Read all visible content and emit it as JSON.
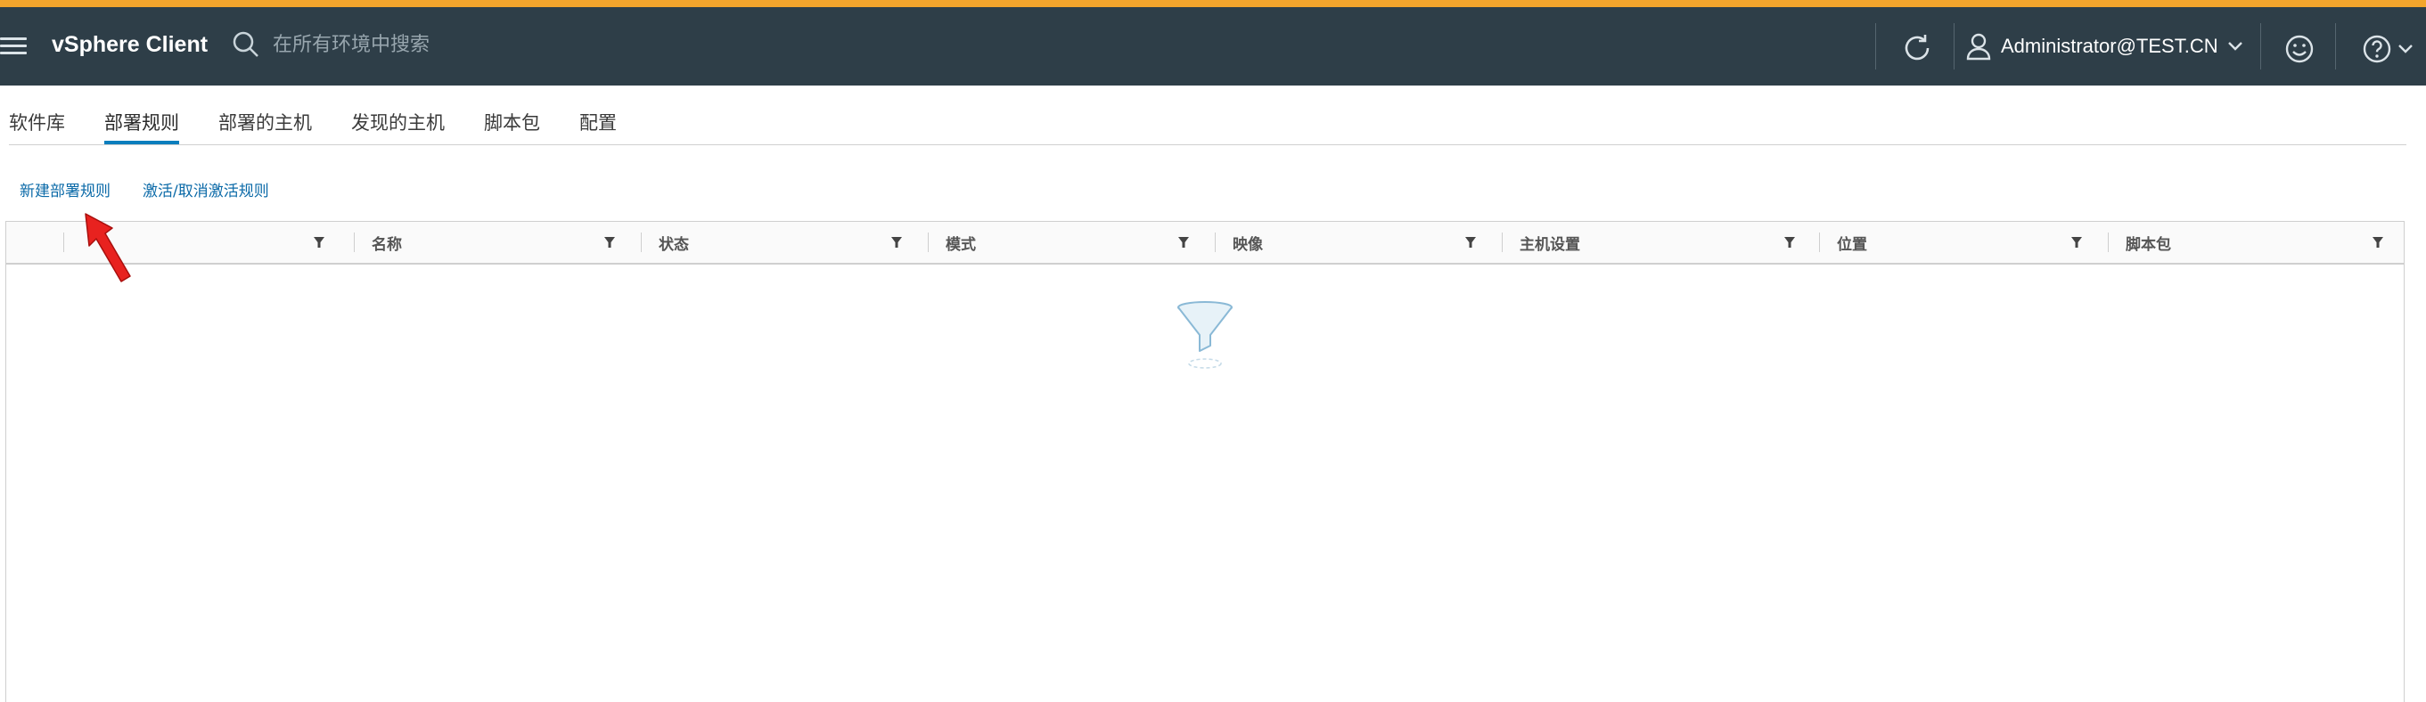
{
  "header": {
    "title": "vSphere Client",
    "search_placeholder": "在所有环境中搜索",
    "user": "Administrator@TEST.CN",
    "icons": [
      "menu-icon",
      "search-icon",
      "refresh-icon",
      "user-icon",
      "chevron-down-icon",
      "smiley-icon",
      "help-icon"
    ]
  },
  "colors": {
    "topbar": "#2e3e48",
    "accent_strip": "#f3a52c",
    "link": "#0b6aa8",
    "tab_active": "#0b7ebd"
  },
  "tabs": [
    {
      "label": "软件库",
      "active": false
    },
    {
      "label": "部署规则",
      "active": true
    },
    {
      "label": "部署的主机",
      "active": false
    },
    {
      "label": "发现的主机",
      "active": false
    },
    {
      "label": "脚本包",
      "active": false
    },
    {
      "label": "配置",
      "active": false
    }
  ],
  "actions": {
    "new_rule": "新建部署规则",
    "toggle_rules": "激活/取消激活规则"
  },
  "grid": {
    "columns": [
      "",
      "名称",
      "状态",
      "模式",
      "映像",
      "主机设置",
      "位置",
      "脚本包"
    ]
  }
}
